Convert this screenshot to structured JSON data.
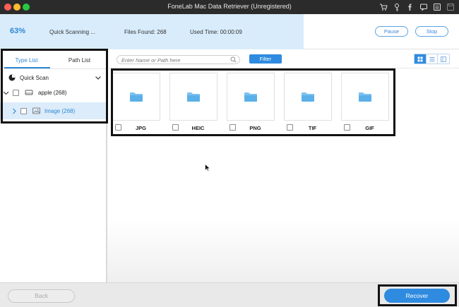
{
  "window": {
    "title": "FoneLab Mac Data Retriever (Unregistered)",
    "icons": [
      "cart-icon",
      "key-icon",
      "facebook-icon",
      "chat-icon",
      "menu-icon",
      "save-icon"
    ]
  },
  "scan": {
    "percent_text": "63%",
    "progress_fraction": 0.63,
    "status": "Quick Scanning ...",
    "files_found": "Files Found: 268",
    "used_time": "Used Time: 00:00:09",
    "pause_label": "Pause",
    "stop_label": "Stop"
  },
  "sidebar": {
    "tabs": [
      {
        "label": "Type List",
        "active": true
      },
      {
        "label": "Path List",
        "active": false
      }
    ],
    "scan_mode": "Quick Scan",
    "disk": {
      "label": "apple (268)"
    },
    "category": {
      "label": "Image (268)",
      "selected": true
    }
  },
  "toolbar": {
    "search_placeholder": "Enter Name or Path here",
    "filter_label": "Filter",
    "view_modes": [
      "grid-view-icon",
      "list-view-icon",
      "column-view-icon"
    ],
    "active_view": "grid-view-icon"
  },
  "folders": [
    {
      "name": "JPG"
    },
    {
      "name": "HEIC"
    },
    {
      "name": "PNG"
    },
    {
      "name": "TIF"
    },
    {
      "name": "GIF"
    }
  ],
  "footer": {
    "back_label": "Back",
    "recover_label": "Recover"
  },
  "colors": {
    "accent": "#2f8be0",
    "progress_bg": "#d9ecfb",
    "selected_row": "#dcecfa",
    "titlebar": "#2b2b2b"
  }
}
